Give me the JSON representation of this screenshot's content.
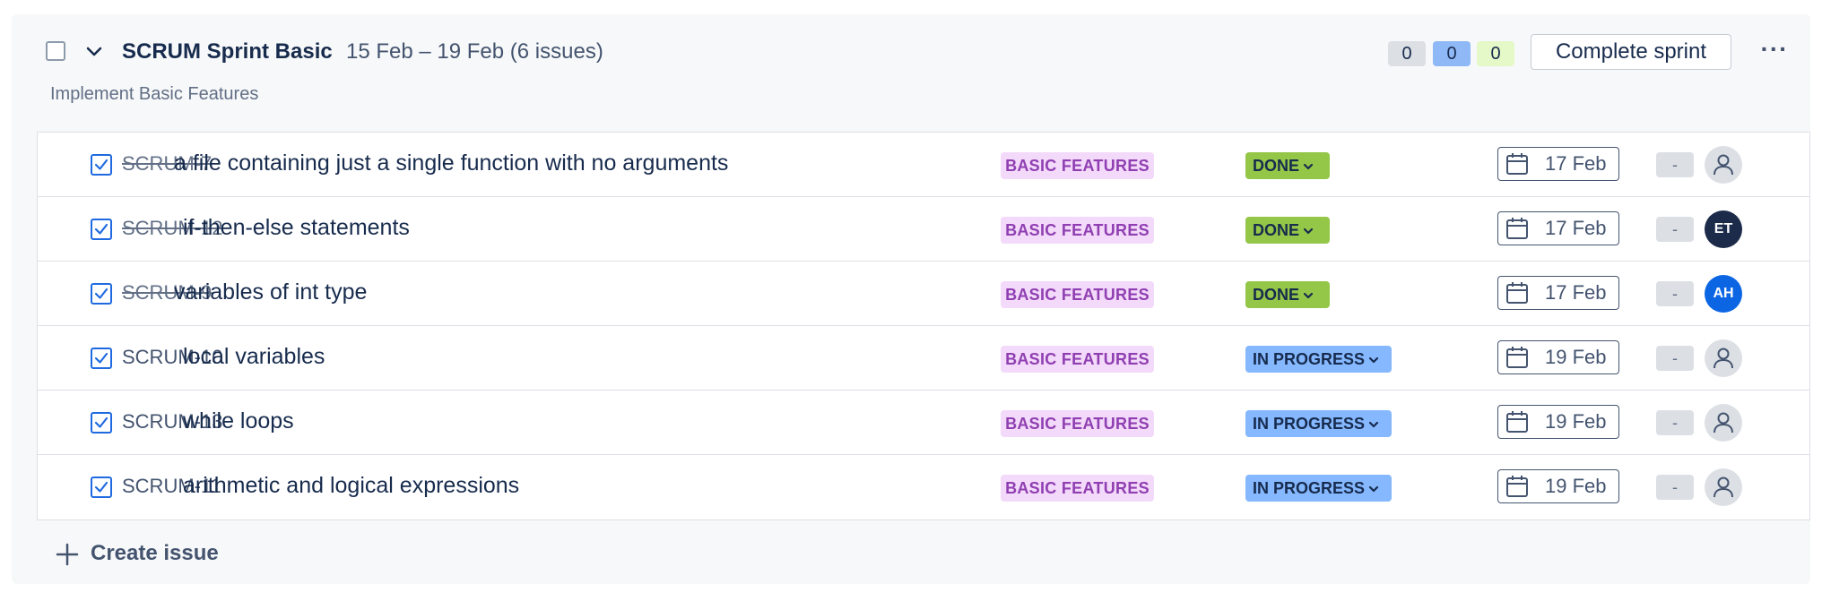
{
  "sprint": {
    "name": "SCRUM Sprint Basic",
    "meta": "15 Feb – 19 Feb (6 issues)",
    "goal": "Implement Basic Features",
    "counts": {
      "todo": "0",
      "in_progress": "0",
      "done": "0"
    },
    "complete_label": "Complete sprint",
    "more_label": "···"
  },
  "issues": [
    {
      "key": "SCRUM-7",
      "summary": "a file containing just a single function with no arguments",
      "epic": "BASIC FEATURES",
      "status": "DONE",
      "due": "17 Feb",
      "estimate": "-",
      "assignee": ""
    },
    {
      "key": "SCRUM-12",
      "summary": "if-then-else statements",
      "epic": "BASIC FEATURES",
      "status": "DONE",
      "due": "17 Feb",
      "estimate": "-",
      "assignee": "ET"
    },
    {
      "key": "SCRUM-9",
      "summary": "variables of int type",
      "epic": "BASIC FEATURES",
      "status": "DONE",
      "due": "17 Feb",
      "estimate": "-",
      "assignee": "AH"
    },
    {
      "key": "SCRUM-10",
      "summary": "local variables",
      "epic": "BASIC FEATURES",
      "status": "IN PROGRESS",
      "due": "19 Feb",
      "estimate": "-",
      "assignee": ""
    },
    {
      "key": "SCRUM-13",
      "summary": "while loops",
      "epic": "BASIC FEATURES",
      "status": "IN PROGRESS",
      "due": "19 Feb",
      "estimate": "-",
      "assignee": ""
    },
    {
      "key": "SCRUM-11",
      "summary": "arithmetic and logical expressions",
      "epic": "BASIC FEATURES",
      "status": "IN PROGRESS",
      "due": "19 Feb",
      "estimate": "-",
      "assignee": ""
    }
  ],
  "create_label": "Create issue",
  "colors": {
    "done_status": "#94c748",
    "in_progress_status": "#85b8ff",
    "epic_bg": "#f3d9fa",
    "epic_text": "#8f3fb1",
    "avatar_et": "#1d2b4a",
    "avatar_ah": "#0c66e4"
  }
}
